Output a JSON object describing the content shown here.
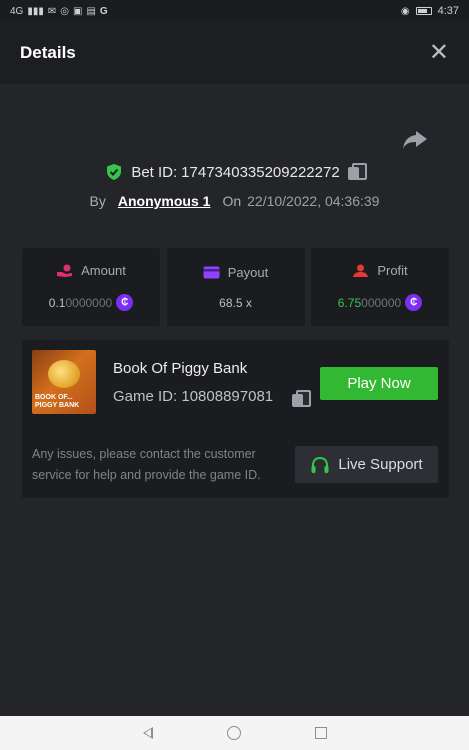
{
  "status_bar": {
    "network": "4G",
    "time": "4:37"
  },
  "header": {
    "title": "Details"
  },
  "bet": {
    "label": "Bet ID:",
    "id": "1747340335209222272",
    "by_label": "By",
    "user": "Anonymous 1",
    "on_label": "On",
    "datetime": "22/10/2022, 04:36:39"
  },
  "stats": {
    "amount": {
      "label": "Amount",
      "value_main": "0.1",
      "value_dim": "0000000"
    },
    "payout": {
      "label": "Payout",
      "value": "68.5 x"
    },
    "profit": {
      "label": "Profit",
      "value_main": "6.75",
      "value_dim": "000000"
    }
  },
  "coin_symbol": "₵",
  "game": {
    "name": "Book Of Piggy Bank",
    "id_label": "Game ID:",
    "id": "10808897081",
    "thumb_text": "BOOK OF... PIGGY BANK",
    "play_label": "Play Now"
  },
  "support": {
    "text": "Any issues, please contact the customer service for help and provide the game ID.",
    "button_label": "Live Support"
  },
  "colors": {
    "background": "#232529",
    "panel": "#1b1c20",
    "play_green": "#32b832",
    "profit_green": "#35c64b",
    "coin_purple": "#7b2ff0",
    "amount_icon": "#e0306b",
    "payout_icon": "#8e44ff",
    "profit_icon": "#e53935"
  },
  "icons": {
    "share": "share-arrow-icon",
    "verified": "shield-check-icon",
    "copy": "copy-icon",
    "amount": "hand-coins-icon",
    "payout": "card-icon",
    "profit": "person-money-icon",
    "support": "headset-icon",
    "close": "close-icon"
  }
}
